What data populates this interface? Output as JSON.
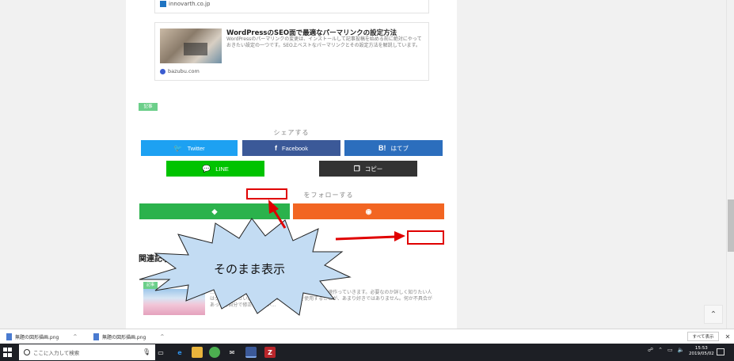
{
  "cards": [
    {
      "domain": "innovarth.co.jp"
    },
    {
      "title": "WordPressのSEO面で最適なパーマリンクの設定方法",
      "description": "WordPressのパーマリンクの変更は、インストールして記事投稿を始める前に絶対にやっておきたい設定の一つです。SEO上ベストなパーマリンクとその設定方法を解説しています。",
      "domain": "bazubu.com"
    }
  ],
  "tag_label": "記事",
  "share": {
    "label": "シェアする",
    "twitter": "Twitter",
    "facebook": "Facebook",
    "hatena_icon": "B!",
    "hatena": "はてブ",
    "line": "LINE",
    "copy": "コピー"
  },
  "follow": {
    "label": "をフォローする"
  },
  "related": {
    "heading": "関連記事",
    "tag": "記事",
    "description": "…ためには「お問い合わせ」が必要ってことなので、早速作っていきます。必要なのか詳しく知りたい人はググって下さい。まず、私はプラグインを使用することが、あまり好きではありません。何か不具合があっても自分で修正できない…"
  },
  "annotation": {
    "text": "そのまま表示"
  },
  "downloads": {
    "items": [
      "無題の図形描画.png",
      "無題の図形描画.png"
    ],
    "show_all": "すべて表示"
  },
  "taskbar": {
    "search_placeholder": "ここに入力して検索",
    "time": "15:53",
    "date": "2019/05/02"
  },
  "colors": {
    "twitter": "#1da1f2",
    "facebook": "#3b5998",
    "hatena": "#2c6ebd",
    "line": "#00c300",
    "copy": "#333333",
    "feedly": "#2bb24c",
    "rss": "#f26522",
    "annotation_red": "#e00000",
    "starburst_fill": "#c3dcf3"
  }
}
